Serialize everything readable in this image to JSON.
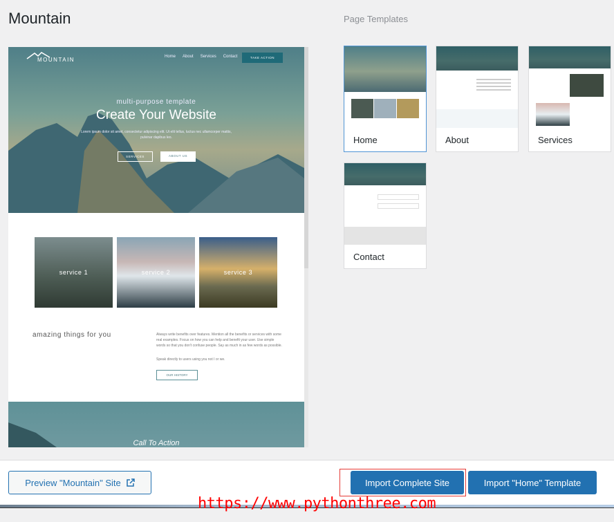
{
  "title": "Mountain",
  "templates_heading": "Page Templates",
  "preview": {
    "logo": "MOUNTAIN",
    "nav": [
      "Home",
      "About",
      "Services",
      "Contact"
    ],
    "nav_button": "TAKE ACTION",
    "subtitle": "multi-purpose template",
    "headline": "Create Your Website",
    "lorem": "Lorem ipsum dolor sit amet, consectetur adipiscing elit. Ut elit tellus, luctus nec ullamcorper mattis, pulvinar dapibus leo.",
    "btn_services": "SERVICES",
    "btn_about": "ABOUT US",
    "services": [
      "service 1",
      "service 2",
      "service 3"
    ],
    "amazing": "amazing things for you",
    "body1": "Always write benefits over features. Mention all the benefits or services with some real examples. Focus on how you can help and benefit your user. Use simple words so that you don't confuse people. Say as much in as few words as possible.",
    "body2": "Speak directly to users using you not I or we.",
    "history_btn": "OUR HISTORY",
    "cta": "Call To Action"
  },
  "templates": [
    {
      "label": "Home",
      "selected": true
    },
    {
      "label": "About",
      "selected": false
    },
    {
      "label": "Services",
      "selected": false
    },
    {
      "label": "Contact",
      "selected": false
    }
  ],
  "footer": {
    "preview_btn": "Preview \"Mountain\" Site",
    "import_site": "Import Complete Site",
    "import_template": "Import \"Home\" Template"
  },
  "watermark": "https://www.pythonthree.com",
  "colors": {
    "primary": "#2271b1",
    "teal": "#1f6a78",
    "highlight": "#e53935"
  }
}
